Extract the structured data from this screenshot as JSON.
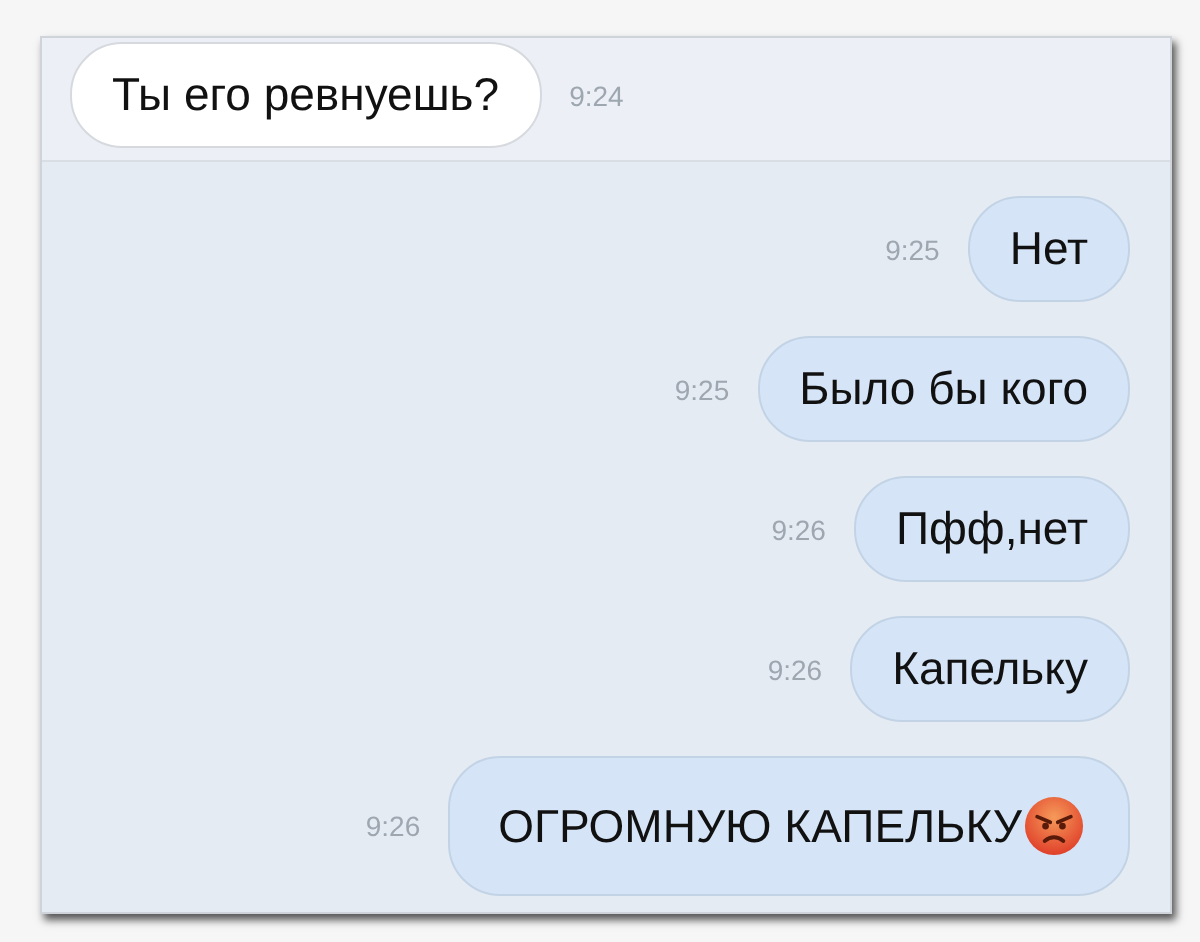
{
  "messages": [
    {
      "kind": "incoming",
      "text": "Ты его ревнуешь?",
      "time": "9:24"
    },
    {
      "kind": "outgoing",
      "text": "Нет",
      "time": "9:25"
    },
    {
      "kind": "outgoing",
      "text": "Было бы кого",
      "time": "9:25"
    },
    {
      "kind": "outgoing",
      "text": "Пфф,нет",
      "time": "9:26"
    },
    {
      "kind": "outgoing",
      "text": "Капельку",
      "time": "9:26"
    },
    {
      "kind": "angry",
      "text": "ОГРОМНУЮ КАПЕЛЬКУ",
      "time": "9:26"
    }
  ]
}
